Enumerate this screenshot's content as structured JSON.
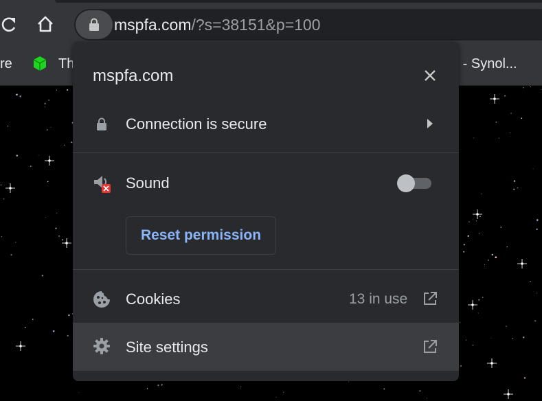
{
  "toolbar": {
    "url_host": "mspfa.com",
    "url_path": "/?s=38151&p=100"
  },
  "bookmarks": {
    "left_partial": "re",
    "item_partial": "Th",
    "right_item": "d - Synol..."
  },
  "bubble": {
    "title": "mspfa.com",
    "connection_label": "Connection is secure",
    "sound_label": "Sound",
    "sound_enabled": false,
    "reset_label": "Reset permission",
    "cookies_label": "Cookies",
    "cookies_count": "13 in use",
    "site_settings_label": "Site settings"
  },
  "colors": {
    "toolbar_bg": "#35363a",
    "popup_bg": "#292a2d",
    "hover_bg": "#3c3d41",
    "link_blue": "#8ab4f8",
    "text": "#e8eaed",
    "muted": "#9aa0a6"
  },
  "icons": [
    "reload-icon",
    "home-icon",
    "lock-icon",
    "close-icon",
    "chevron-right-icon",
    "sound-blocked-icon",
    "cookie-icon",
    "gear-icon",
    "external-link-icon"
  ]
}
